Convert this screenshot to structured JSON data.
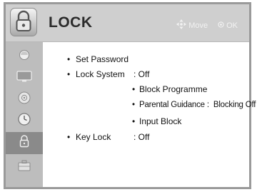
{
  "header": {
    "title": "LOCK",
    "move_label": "Move",
    "ok_label": "OK"
  },
  "sidebar": {
    "items": [
      {
        "icon": "picture-icon"
      },
      {
        "icon": "screen-icon"
      },
      {
        "icon": "audio-disc-icon"
      },
      {
        "icon": "clock-icon"
      },
      {
        "icon": "lock-icon",
        "active": true
      },
      {
        "icon": "option-icon"
      }
    ]
  },
  "menu": {
    "set_password": "Set Password",
    "lock_system": {
      "label": "Lock System",
      "value": ": Off"
    },
    "block_programme": "Block Programme",
    "parental_guidance": {
      "label": "Parental Guidance :",
      "value": "Blocking Off"
    },
    "input_block": "Input Block",
    "key_lock": {
      "label": "Key Lock",
      "value": ": Off"
    }
  },
  "bullet": "•"
}
